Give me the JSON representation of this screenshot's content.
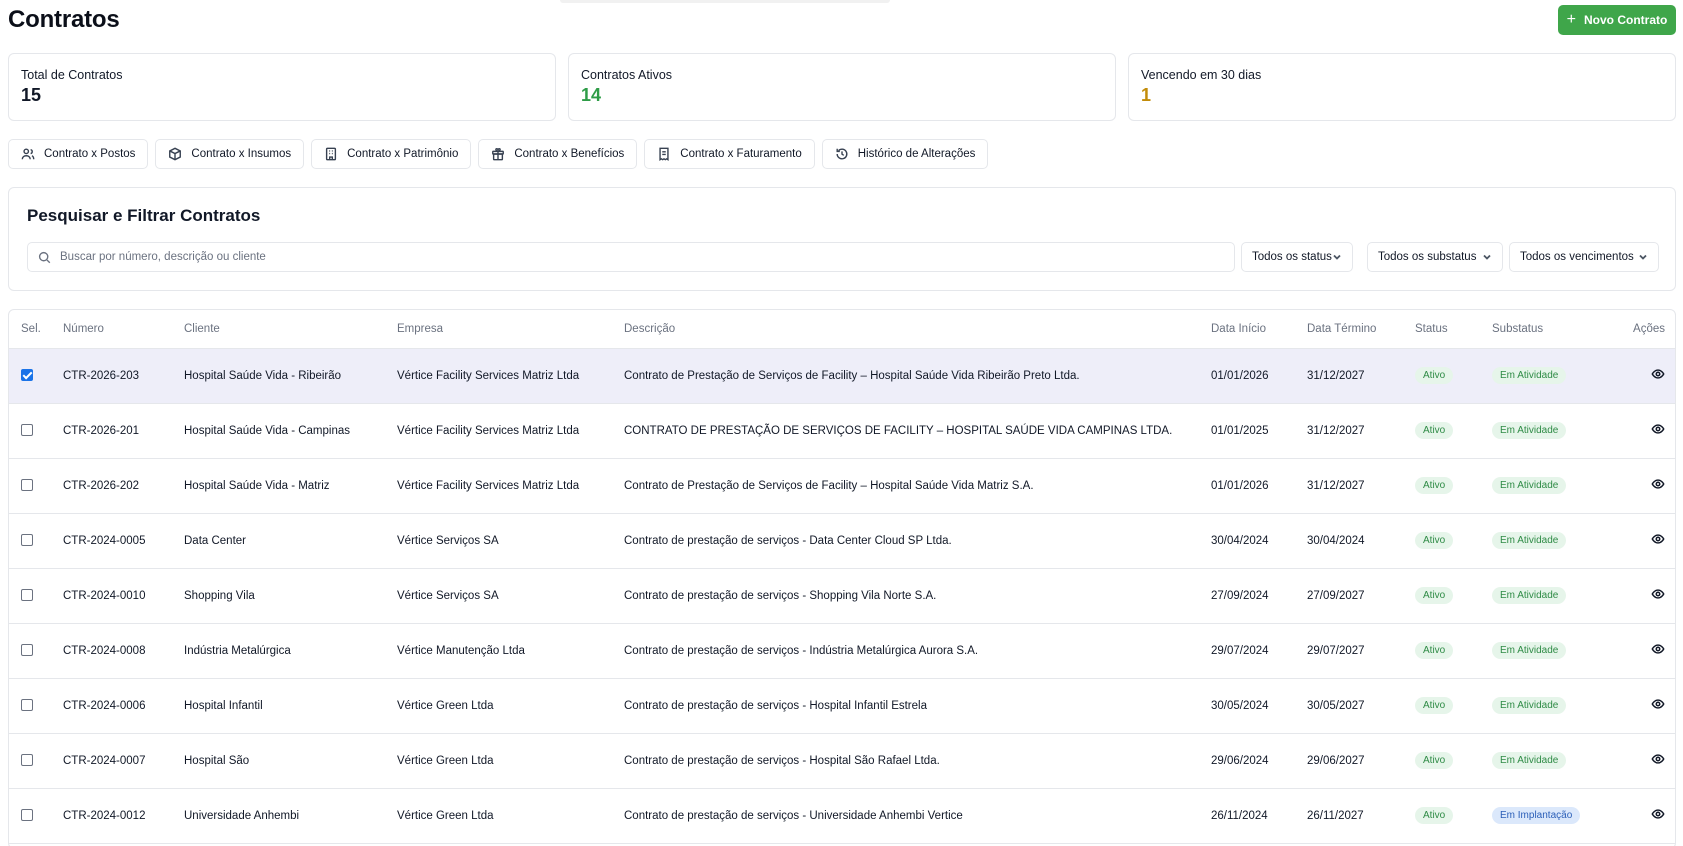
{
  "page": {
    "title": "Contratos",
    "new_button": "Novo Contrato"
  },
  "summary": [
    {
      "label": "Total de Contratos",
      "value": "15",
      "color": "#111827"
    },
    {
      "label": "Contratos Ativos",
      "value": "14",
      "color": "#2e9c47"
    },
    {
      "label": "Vencendo em 30 dias",
      "value": "1",
      "color": "#c28c0a"
    }
  ],
  "tools": [
    {
      "label": "Contrato x Postos",
      "icon": "users-icon"
    },
    {
      "label": "Contrato x Insumos",
      "icon": "box-icon"
    },
    {
      "label": "Contrato x Patrimônio",
      "icon": "building-icon"
    },
    {
      "label": "Contrato x Benefícios",
      "icon": "gift-icon"
    },
    {
      "label": "Contrato x Faturamento",
      "icon": "receipt-icon"
    },
    {
      "label": "Histórico de Alterações",
      "icon": "history-icon"
    }
  ],
  "filters": {
    "title": "Pesquisar e Filtrar Contratos",
    "search_placeholder": "Buscar por número, descrição ou cliente",
    "status": "Todos os status",
    "substatus": "Todos os substatus",
    "vencimentos": "Todos os vencimentos"
  },
  "table": {
    "headers": {
      "sel": "Sel.",
      "numero": "Número",
      "cliente": "Cliente",
      "empresa": "Empresa",
      "descricao": "Descrição",
      "inicio": "Data Início",
      "termino": "Data Término",
      "status": "Status",
      "substatus": "Substatus",
      "acoes": "Ações"
    },
    "rows": [
      {
        "selected": true,
        "numero": "CTR-2026-203",
        "cliente": "Hospital Saúde Vida - Ribeirão",
        "empresa": "Vértice Facility Services Matriz Ltda",
        "descricao": "Contrato de Prestação de Serviços de Facility – Hospital Saúde Vida Ribeirão Preto Ltda.",
        "inicio": "01/01/2026",
        "termino": "31/12/2027",
        "status": "Ativo",
        "substatus": "Em Atividade"
      },
      {
        "selected": false,
        "numero": "CTR-2026-201",
        "cliente": "Hospital Saúde Vida - Campinas",
        "empresa": "Vértice Facility Services Matriz Ltda",
        "descricao": "CONTRATO DE PRESTAÇÃO DE SERVIÇOS DE FACILITY – HOSPITAL SAÚDE VIDA CAMPINAS LTDA.",
        "inicio": "01/01/2025",
        "termino": "31/12/2027",
        "status": "Ativo",
        "substatus": "Em Atividade"
      },
      {
        "selected": false,
        "numero": "CTR-2026-202",
        "cliente": "Hospital Saúde Vida - Matriz",
        "empresa": "Vértice Facility Services Matriz Ltda",
        "descricao": "Contrato de Prestação de Serviços de Facility – Hospital Saúde Vida Matriz S.A.",
        "inicio": "01/01/2026",
        "termino": "31/12/2027",
        "status": "Ativo",
        "substatus": "Em Atividade"
      },
      {
        "selected": false,
        "numero": "CTR-2024-0005",
        "cliente": "Data Center",
        "empresa": "Vértice Serviços SA",
        "descricao": "Contrato de prestação de serviços - Data Center Cloud SP Ltda.",
        "inicio": "30/04/2024",
        "termino": "30/04/2024",
        "status": "Ativo",
        "substatus": "Em Atividade"
      },
      {
        "selected": false,
        "numero": "CTR-2024-0010",
        "cliente": "Shopping Vila",
        "empresa": "Vértice Serviços SA",
        "descricao": "Contrato de prestação de serviços - Shopping Vila Norte S.A.",
        "inicio": "27/09/2024",
        "termino": "27/09/2027",
        "status": "Ativo",
        "substatus": "Em Atividade"
      },
      {
        "selected": false,
        "numero": "CTR-2024-0008",
        "cliente": "Indústria Metalúrgica",
        "empresa": "Vértice Manutenção Ltda",
        "descricao": "Contrato de prestação de serviços - Indústria Metalúrgica Aurora S.A.",
        "inicio": "29/07/2024",
        "termino": "29/07/2027",
        "status": "Ativo",
        "substatus": "Em Atividade"
      },
      {
        "selected": false,
        "numero": "CTR-2024-0006",
        "cliente": "Hospital Infantil",
        "empresa": "Vértice Green Ltda",
        "descricao": "Contrato de prestação de serviços - Hospital Infantil Estrela",
        "inicio": "30/05/2024",
        "termino": "30/05/2027",
        "status": "Ativo",
        "substatus": "Em Atividade"
      },
      {
        "selected": false,
        "numero": "CTR-2024-0007",
        "cliente": "Hospital São",
        "empresa": "Vértice Green Ltda",
        "descricao": "Contrato de prestação de serviços - Hospital São Rafael Ltda.",
        "inicio": "29/06/2024",
        "termino": "29/06/2027",
        "status": "Ativo",
        "substatus": "Em Atividade"
      },
      {
        "selected": false,
        "numero": "CTR-2024-0012",
        "cliente": "Universidade Anhembi",
        "empresa": "Vértice Green Ltda",
        "descricao": "Contrato de prestação de serviços - Universidade Anhembi Vertice",
        "inicio": "26/11/2024",
        "termino": "26/11/2027",
        "status": "Ativo",
        "substatus": "Em Implantação"
      }
    ]
  }
}
